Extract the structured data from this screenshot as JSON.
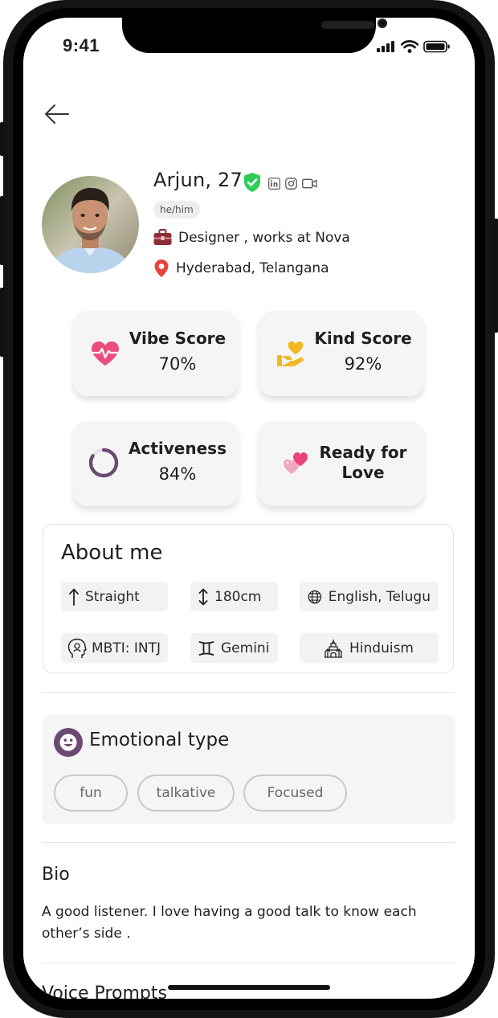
{
  "status_bar": {
    "time": "9:41"
  },
  "profile": {
    "name_age": "Arjun, 27",
    "pronouns": "he/him",
    "occupation": "Designer , works at Nova",
    "location": "Hyderabad, Telangana",
    "verified": true,
    "social_icons": [
      "linkedin-icon",
      "instagram-icon",
      "video-icon"
    ]
  },
  "scores": [
    {
      "title": "Vibe Score",
      "value": "70%",
      "icon": "heart-pulse-icon"
    },
    {
      "title": "Kind Score",
      "value": "92%",
      "icon": "giving-heart-icon"
    },
    {
      "title": "Activeness",
      "value": "84%",
      "icon": "progress-ring-icon",
      "progress": 0.84
    },
    {
      "title_line1": "Ready for",
      "title_line2": "Love",
      "icon": "two-hearts-icon"
    }
  ],
  "about": {
    "title": "About me",
    "items": [
      {
        "icon": "arrow-up-icon",
        "label": "Straight"
      },
      {
        "icon": "height-icon",
        "label": "180cm"
      },
      {
        "icon": "globe-icon",
        "label": "English, Telugu"
      },
      {
        "icon": "head-icon",
        "label": "MBTI: INTJ"
      },
      {
        "icon": "gemini-icon",
        "label": "Gemini"
      },
      {
        "icon": "temple-icon",
        "label": "Hinduism"
      }
    ]
  },
  "emotional": {
    "title": "Emotional type",
    "tags": [
      "fun",
      "talkative",
      "Focused"
    ]
  },
  "bio": {
    "title": "Bio",
    "text": "A good listener. I love having a good talk to know each other’s side ."
  },
  "voice_prompts": {
    "title": "Voice Prompts"
  },
  "colors": {
    "accent_purple": "#6b4a72",
    "verified_green": "#2ecc55",
    "heart_pink": "#ec4d7c",
    "kind_yellow": "#f2b823",
    "location_red": "#e8423a",
    "briefcase": "#8c2f35"
  }
}
